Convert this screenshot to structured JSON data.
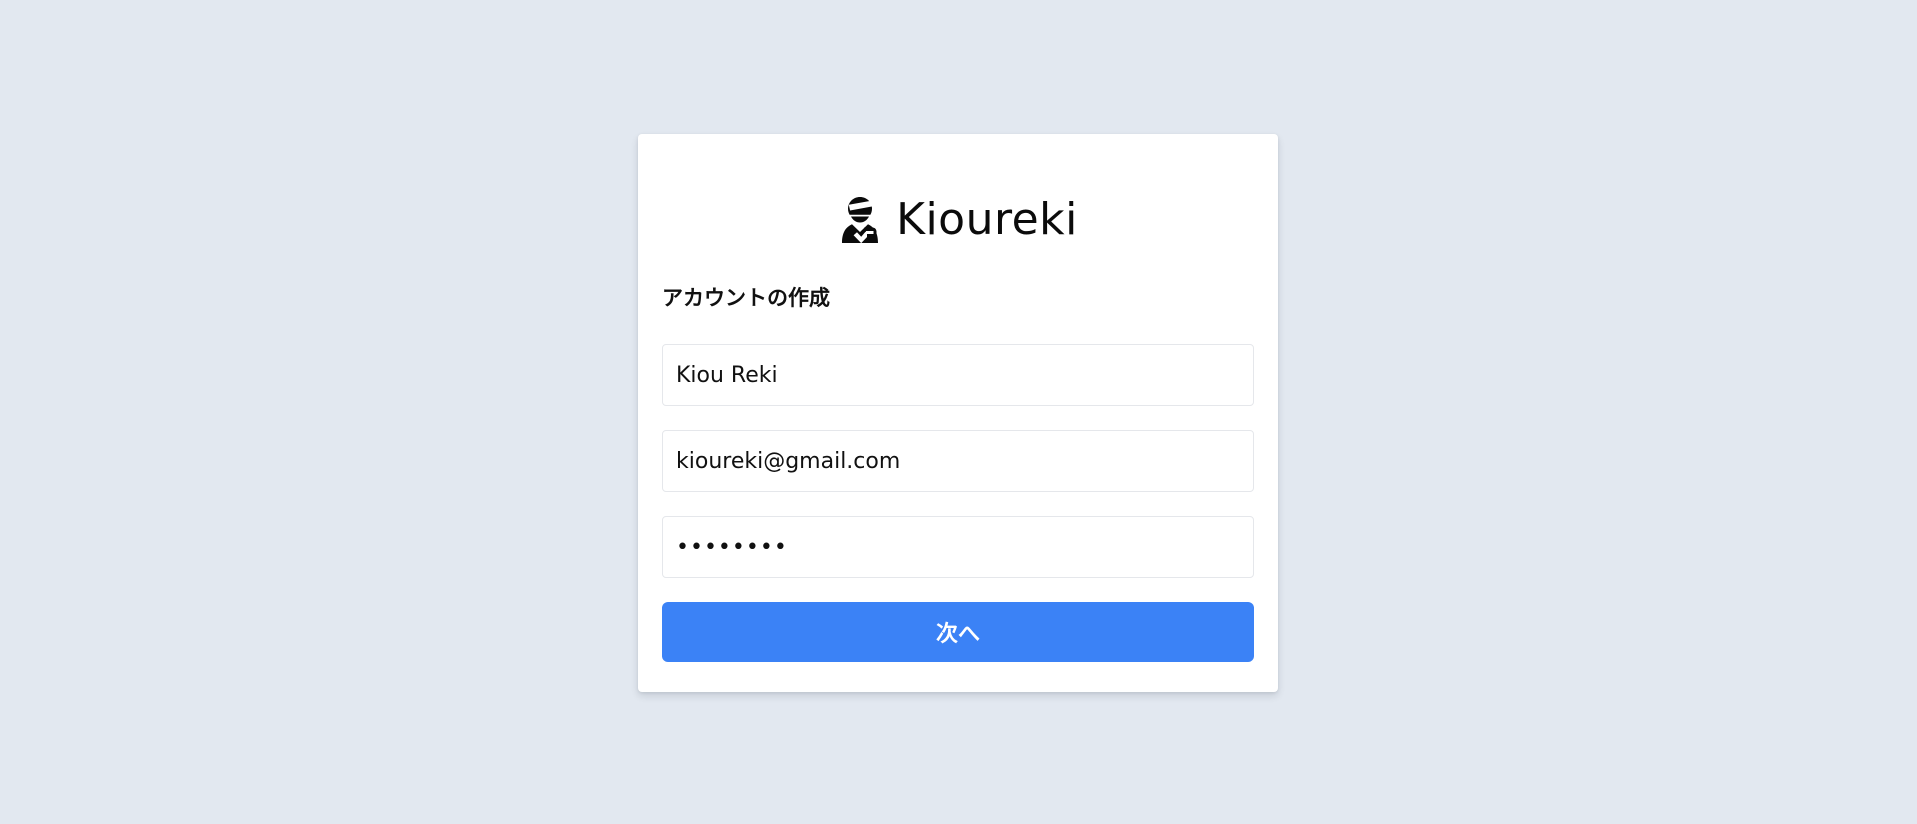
{
  "brand": {
    "name": "Kioureki",
    "icon": "bandaged-person-icon"
  },
  "form": {
    "title": "アカウントの作成",
    "name_value": "Kiou Reki",
    "email_value": "kioureki@gmail.com",
    "password_value": "••••••••",
    "submit_label": "次へ"
  },
  "colors": {
    "background": "#e2e8f0",
    "card": "#ffffff",
    "primary_button": "#3b82f6"
  }
}
